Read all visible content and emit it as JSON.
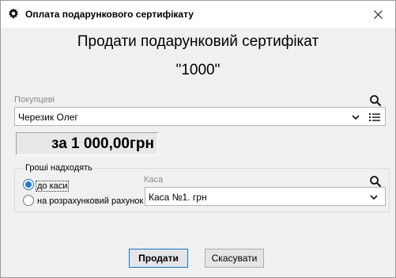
{
  "window": {
    "title": "Оплата подарункового сертифікату",
    "icon": "gear-icon",
    "close_icon": "close-icon"
  },
  "main": {
    "heading": "Продати подарунковий сертифікат",
    "certificate": "\"1000\""
  },
  "buyer": {
    "label": "Покупцеві",
    "value": "Черезик Олег",
    "search_icon": "search-icon",
    "dropdown_icon": "chevron-down-icon",
    "list_icon": "list-icon"
  },
  "amount": {
    "text": "за 1 000,00грн"
  },
  "payment": {
    "group_label": "Гроші надходять",
    "options": [
      {
        "label": "до каси",
        "selected": true
      },
      {
        "label": "на розрахунковий рахунок",
        "selected": false
      }
    ]
  },
  "kasa": {
    "label": "Каса",
    "value": "Каса №1. грн",
    "search_icon": "search-icon",
    "dropdown_icon": "chevron-down-icon"
  },
  "buttons": {
    "sell": "Продати",
    "cancel": "Скасувати"
  },
  "colors": {
    "accent": "#1e78d7",
    "dialog_bg": "#f0f0f0"
  }
}
